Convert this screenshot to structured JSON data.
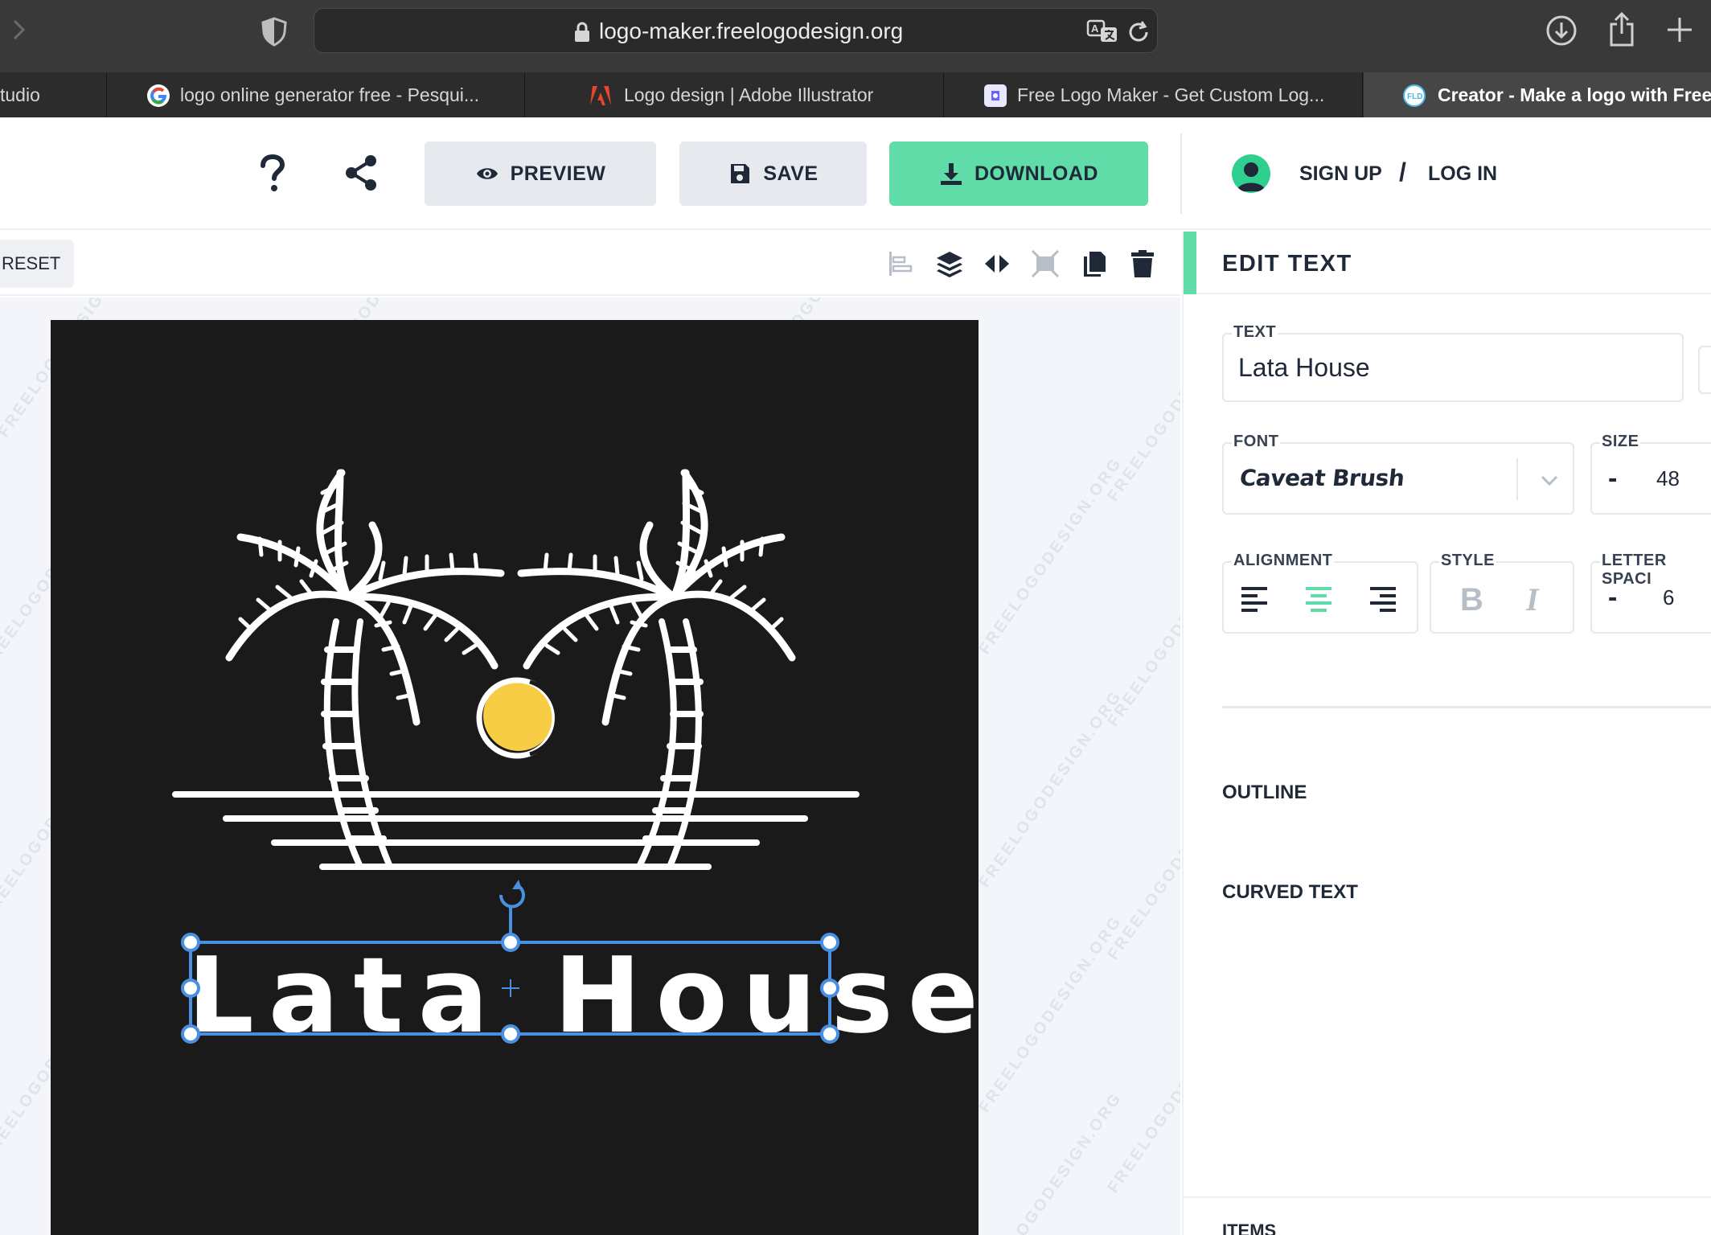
{
  "browser": {
    "url": "logo-maker.freelogodesign.org",
    "tabs": [
      {
        "label": "tudio",
        "active": false
      },
      {
        "label": "logo online generator free - Pesqui...",
        "active": false
      },
      {
        "label": "Logo design | Adobe Illustrator",
        "active": false
      },
      {
        "label": "Free Logo Maker - Get Custom Log...",
        "active": false
      },
      {
        "label": "Creator - Make a logo with Free L",
        "active": true
      }
    ]
  },
  "header": {
    "preview_label": "PREVIEW",
    "save_label": "SAVE",
    "download_label": "DOWNLOAD",
    "signup_label": "SIGN UP",
    "separator": "/",
    "login_label": "LOG IN",
    "download_color": "#5fdca8"
  },
  "editor": {
    "reset_label": "RESET",
    "watermark": "FREELOGODESIGN.ORG",
    "logo_text": "Lata House",
    "sun_color": "#f8cd46",
    "selection_color": "#4a90e2",
    "background_color": "#1a1a1a"
  },
  "panel": {
    "title": "EDIT TEXT",
    "text_label": "TEXT",
    "text_value": "Lata House",
    "font_label": "FONT",
    "font_value": "Caveat Brush",
    "size_label": "SIZE",
    "size_minus": "-",
    "size_value": "48",
    "alignment_label": "ALIGNMENT",
    "alignment_selected": "center",
    "style_label": "STYLE",
    "letter_spacing_label": "LETTER SPACI",
    "letter_spacing_minus": "-",
    "letter_spacing_value": "6",
    "outline_label": "OUTLINE",
    "curved_text_label": "CURVED TEXT",
    "items_label": "ITEMS",
    "accent_color": "#5fdca8"
  }
}
